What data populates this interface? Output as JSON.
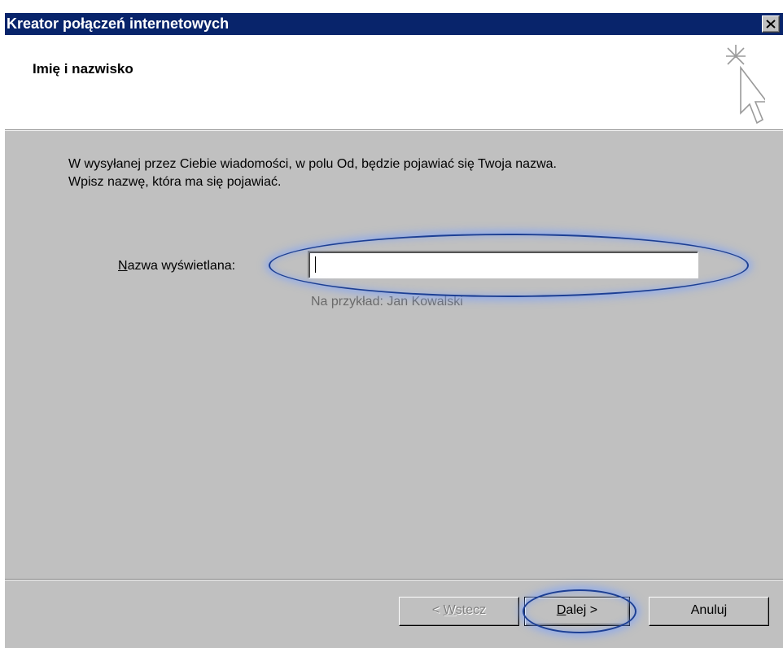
{
  "window": {
    "title": "Kreator połączeń internetowych",
    "close_glyph": "✕"
  },
  "header": {
    "title": "Imię i nazwisko",
    "icon": "wizard-sparkle-cursor-icon"
  },
  "content": {
    "intro_line1": "W wysyłanej przez Ciebie wiadomości, w polu Od, będzie pojawiać się Twoja nazwa.",
    "intro_line2": "Wpisz nazwę, która ma się pojawiać.",
    "field_label_mnemonic": "N",
    "field_label_rest": "azwa wyświetlana:",
    "field_value": "",
    "example": "Na przykład: Jan Kowalski"
  },
  "buttons": {
    "back_prefix": "< ",
    "back_mnemonic": "W",
    "back_rest": "stecz",
    "next_mnemonic": "D",
    "next_rest": "alej >",
    "cancel": "Anuluj"
  },
  "colors": {
    "titlebar": "#08246b",
    "dialog_face": "#c0c0c0",
    "highlight": "#1c3f95"
  }
}
